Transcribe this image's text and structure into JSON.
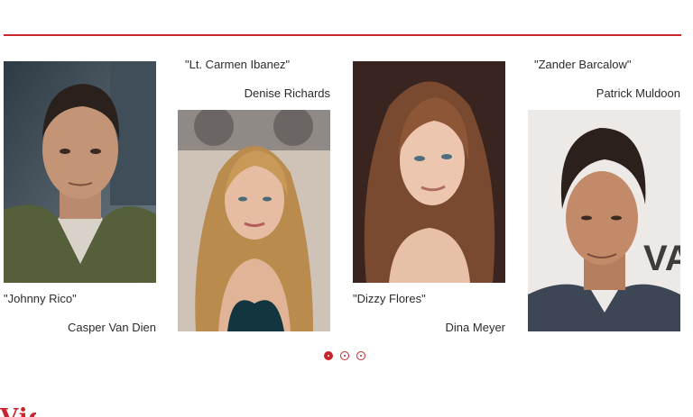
{
  "cast": [
    {
      "role": "\"Johnny Rico\"",
      "actor": "Casper Van Dien"
    },
    {
      "role": "\"Lt. Carmen Ibanez\"",
      "actor": "Denise Richards"
    },
    {
      "role": "\"Dizzy Flores\"",
      "actor": "Dina Meyer"
    },
    {
      "role": "\"Zander Barcalow\"",
      "actor": "Patrick Muldoon"
    }
  ],
  "carousel": {
    "pages": 3,
    "active_page": 1
  },
  "next_section": {
    "heading": "Vid"
  },
  "colors": {
    "accent": "#c9252c",
    "text": "#2b2b2b",
    "background": "#ffffff"
  }
}
